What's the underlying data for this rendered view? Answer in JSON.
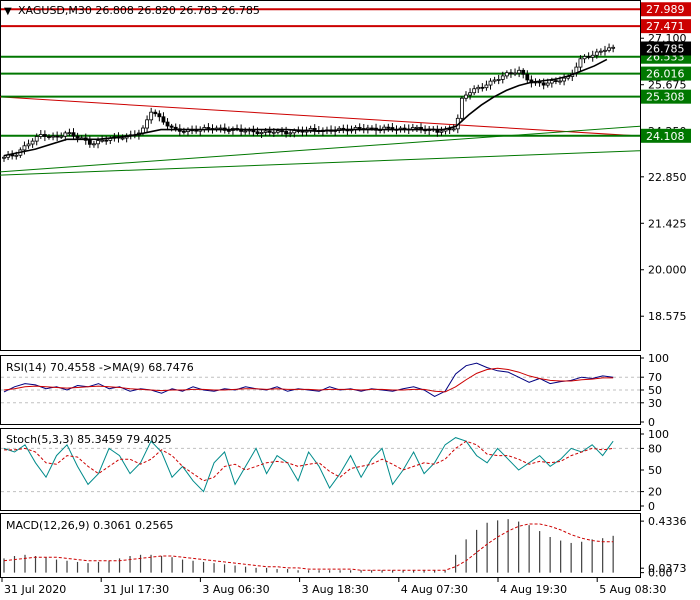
{
  "colors": {
    "frame": "#000000",
    "grid": "#c0c0c0",
    "resistance": "#cc0000",
    "support": "#007700",
    "candle_up": "#ffffff",
    "candle_down": "#000000",
    "ma_line": "#000000",
    "rsi_line": "#000080",
    "rsi_ma": "#cc0000",
    "stoch_main": "#008b8b",
    "stoch_signal": "#cc0000",
    "macd_hist": "#404040",
    "macd_signal": "#cc0000",
    "price_label_bg": "#000000",
    "price_label_text": "#ffffff"
  },
  "header": {
    "symbol_label": "XAGUSD,M30 26.808 26.820 26.783 26.785"
  },
  "chart_data": [
    {
      "type": "candlestick",
      "name": "price",
      "ylim": [
        17.6,
        28.15
      ],
      "y_ticks": [
        "27.100",
        "25.675",
        "24.250",
        "22.850",
        "21.425",
        "20.000",
        "18.575"
      ],
      "y_tick_values": [
        27.1,
        25.675,
        24.25,
        22.85,
        21.425,
        20.0,
        18.575
      ],
      "current_price": "26.785",
      "current_price_value": 26.785,
      "levels": [
        {
          "label": "27.989",
          "value": 27.989,
          "kind": "resistance"
        },
        {
          "label": "27.471",
          "value": 27.471,
          "kind": "resistance"
        },
        {
          "label": "26.533",
          "value": 26.533,
          "kind": "support"
        },
        {
          "label": "26.016",
          "value": 26.016,
          "kind": "support"
        },
        {
          "label": "25.308",
          "value": 25.308,
          "kind": "support"
        },
        {
          "label": "24.108",
          "value": 24.108,
          "kind": "support"
        }
      ],
      "trendlines": [
        {
          "kind": "resistance",
          "from": [
            0,
            25.3
          ],
          "to": [
            1,
            24.1
          ]
        },
        {
          "kind": "support",
          "from": [
            0,
            23.0
          ],
          "to": [
            1,
            24.4
          ]
        },
        {
          "kind": "support",
          "from": [
            0,
            22.9
          ],
          "to": [
            1,
            23.65
          ]
        }
      ],
      "close_path": [
        [
          0.0,
          23.45
        ],
        [
          0.02,
          23.55
        ],
        [
          0.04,
          23.9
        ],
        [
          0.06,
          24.15
        ],
        [
          0.08,
          24.05
        ],
        [
          0.1,
          24.2
        ],
        [
          0.12,
          24.05
        ],
        [
          0.14,
          23.85
        ],
        [
          0.16,
          24.0
        ],
        [
          0.18,
          24.05
        ],
        [
          0.2,
          24.1
        ],
        [
          0.22,
          24.25
        ],
        [
          0.235,
          24.9
        ],
        [
          0.25,
          24.6
        ],
        [
          0.27,
          24.3
        ],
        [
          0.29,
          24.25
        ],
        [
          0.31,
          24.3
        ],
        [
          0.33,
          24.35
        ],
        [
          0.35,
          24.3
        ],
        [
          0.37,
          24.3
        ],
        [
          0.39,
          24.25
        ],
        [
          0.41,
          24.2
        ],
        [
          0.43,
          24.25
        ],
        [
          0.45,
          24.2
        ],
        [
          0.47,
          24.25
        ],
        [
          0.49,
          24.3
        ],
        [
          0.51,
          24.25
        ],
        [
          0.53,
          24.3
        ],
        [
          0.55,
          24.3
        ],
        [
          0.57,
          24.35
        ],
        [
          0.59,
          24.3
        ],
        [
          0.61,
          24.35
        ],
        [
          0.63,
          24.3
        ],
        [
          0.65,
          24.35
        ],
        [
          0.67,
          24.3
        ],
        [
          0.69,
          24.25
        ],
        [
          0.71,
          24.3
        ],
        [
          0.72,
          24.4
        ],
        [
          0.73,
          25.3
        ],
        [
          0.745,
          25.5
        ],
        [
          0.76,
          25.6
        ],
        [
          0.78,
          25.8
        ],
        [
          0.8,
          26.0
        ],
        [
          0.82,
          26.1
        ],
        [
          0.83,
          25.9
        ],
        [
          0.84,
          25.75
        ],
        [
          0.86,
          25.7
        ],
        [
          0.88,
          25.8
        ],
        [
          0.9,
          25.9
        ],
        [
          0.91,
          26.2
        ],
        [
          0.92,
          26.5
        ],
        [
          0.94,
          26.6
        ],
        [
          0.96,
          26.8
        ],
        [
          0.97,
          26.785
        ]
      ],
      "ma_path": [
        [
          0.0,
          23.5
        ],
        [
          0.05,
          23.7
        ],
        [
          0.1,
          24.0
        ],
        [
          0.15,
          24.0
        ],
        [
          0.2,
          24.1
        ],
        [
          0.25,
          24.3
        ],
        [
          0.3,
          24.3
        ],
        [
          0.35,
          24.3
        ],
        [
          0.4,
          24.3
        ],
        [
          0.45,
          24.3
        ],
        [
          0.5,
          24.25
        ],
        [
          0.55,
          24.3
        ],
        [
          0.6,
          24.3
        ],
        [
          0.65,
          24.3
        ],
        [
          0.7,
          24.3
        ],
        [
          0.72,
          24.4
        ],
        [
          0.74,
          24.75
        ],
        [
          0.76,
          25.05
        ],
        [
          0.78,
          25.3
        ],
        [
          0.8,
          25.5
        ],
        [
          0.82,
          25.65
        ],
        [
          0.84,
          25.75
        ],
        [
          0.86,
          25.8
        ],
        [
          0.88,
          25.85
        ],
        [
          0.9,
          25.95
        ],
        [
          0.92,
          26.1
        ],
        [
          0.94,
          26.25
        ],
        [
          0.96,
          26.45
        ]
      ]
    },
    {
      "type": "line",
      "name": "RSI",
      "label": "RSI(14) 70.4558 ->MA(9) 68.7476",
      "ylim": [
        0,
        100
      ],
      "y_ticks": [
        "100",
        "70",
        "50",
        "30",
        "0"
      ],
      "y_tick_values": [
        100,
        70,
        50,
        30,
        0
      ],
      "levels": [
        70,
        50,
        30
      ],
      "series": [
        {
          "name": "RSI(14)",
          "values": [
            47,
            55,
            60,
            58,
            52,
            55,
            50,
            57,
            55,
            60,
            52,
            55,
            48,
            52,
            50,
            45,
            52,
            48,
            55,
            50,
            48,
            52,
            50,
            55,
            52,
            50,
            55,
            48,
            52,
            50,
            48,
            55,
            50,
            52,
            48,
            52,
            50,
            48,
            52,
            55,
            50,
            40,
            48,
            75,
            88,
            92,
            85,
            80,
            78,
            70,
            62,
            68,
            60,
            63,
            65,
            70,
            68,
            72,
            70
          ]
        },
        {
          "name": "MA(9)",
          "values": [
            50,
            52,
            55,
            56,
            55,
            54,
            53,
            54,
            55,
            56,
            55,
            54,
            52,
            51,
            50,
            49,
            50,
            50,
            51,
            51,
            50,
            50,
            51,
            52,
            52,
            51,
            52,
            51,
            51,
            51,
            50,
            51,
            51,
            51,
            50,
            51,
            51,
            50,
            50,
            51,
            51,
            48,
            47,
            55,
            66,
            76,
            82,
            84,
            82,
            78,
            72,
            68,
            65,
            64,
            64,
            66,
            67,
            69,
            69
          ]
        }
      ]
    },
    {
      "type": "line",
      "name": "Stochastic",
      "label": "Stoch(5,3,3) 85.3459 79.4025",
      "ylim": [
        0,
        100
      ],
      "y_ticks": [
        "100",
        "80",
        "50",
        "20",
        "0"
      ],
      "y_tick_values": [
        100,
        80,
        50,
        20,
        0
      ],
      "levels": [
        80,
        20
      ],
      "series": [
        {
          "name": "%K",
          "values": [
            80,
            75,
            85,
            60,
            40,
            70,
            85,
            55,
            30,
            45,
            80,
            70,
            45,
            60,
            90,
            75,
            40,
            55,
            35,
            20,
            60,
            75,
            30,
            55,
            80,
            45,
            70,
            60,
            35,
            75,
            55,
            25,
            45,
            70,
            40,
            65,
            80,
            30,
            50,
            75,
            45,
            60,
            85,
            95,
            90,
            70,
            60,
            80,
            65,
            50,
            60,
            70,
            55,
            65,
            80,
            75,
            85,
            70,
            90
          ]
        },
        {
          "name": "%D",
          "values": [
            78,
            78,
            80,
            75,
            60,
            58,
            70,
            68,
            55,
            45,
            55,
            65,
            65,
            58,
            65,
            78,
            70,
            55,
            45,
            35,
            40,
            55,
            58,
            50,
            55,
            60,
            62,
            60,
            55,
            58,
            60,
            48,
            40,
            52,
            55,
            58,
            65,
            58,
            50,
            55,
            60,
            58,
            65,
            80,
            90,
            85,
            72,
            70,
            70,
            65,
            58,
            62,
            60,
            62,
            70,
            75,
            80,
            78,
            80
          ]
        }
      ]
    },
    {
      "type": "bar",
      "name": "MACD",
      "label": "MACD(12,26,9) 0.3061 0.2565",
      "ylim": [
        -0.02,
        0.46
      ],
      "y_ticks": [
        "0.4336",
        "0.0373",
        "0.00"
      ],
      "y_tick_values": [
        0.4336,
        0.0373,
        0.0
      ],
      "series": [
        {
          "name": "MACD",
          "values": [
            0.12,
            0.14,
            0.15,
            0.14,
            0.13,
            0.11,
            0.1,
            0.09,
            0.08,
            0.09,
            0.1,
            0.12,
            0.14,
            0.15,
            0.15,
            0.14,
            0.13,
            0.11,
            0.1,
            0.09,
            0.08,
            0.07,
            0.06,
            0.05,
            0.04,
            0.04,
            0.03,
            0.03,
            0.02,
            0.02,
            0.02,
            0.02,
            0.02,
            0.02,
            0.02,
            0.02,
            0.02,
            0.02,
            0.02,
            0.02,
            0.02,
            0.02,
            0.02,
            0.15,
            0.28,
            0.36,
            0.42,
            0.44,
            0.45,
            0.43,
            0.4,
            0.35,
            0.3,
            0.27,
            0.25,
            0.26,
            0.28,
            0.29,
            0.31
          ]
        },
        {
          "name": "Signal",
          "values": [
            0.1,
            0.11,
            0.12,
            0.13,
            0.13,
            0.13,
            0.12,
            0.11,
            0.1,
            0.1,
            0.1,
            0.1,
            0.11,
            0.12,
            0.13,
            0.14,
            0.14,
            0.13,
            0.12,
            0.11,
            0.1,
            0.09,
            0.08,
            0.07,
            0.06,
            0.05,
            0.05,
            0.04,
            0.04,
            0.03,
            0.03,
            0.03,
            0.03,
            0.03,
            0.02,
            0.02,
            0.02,
            0.02,
            0.02,
            0.02,
            0.02,
            0.02,
            0.02,
            0.05,
            0.1,
            0.17,
            0.24,
            0.3,
            0.35,
            0.39,
            0.41,
            0.41,
            0.39,
            0.36,
            0.32,
            0.29,
            0.27,
            0.26,
            0.26
          ]
        }
      ]
    }
  ],
  "x_axis": {
    "labels": [
      "31 Jul 2020",
      "31 Jul 17:30",
      "3 Aug 06:30",
      "3 Aug 18:30",
      "4 Aug 07:30",
      "4 Aug 19:30",
      "5 Aug 08:30"
    ],
    "positions": [
      0.0,
      0.155,
      0.31,
      0.465,
      0.62,
      0.775,
      0.93
    ]
  }
}
